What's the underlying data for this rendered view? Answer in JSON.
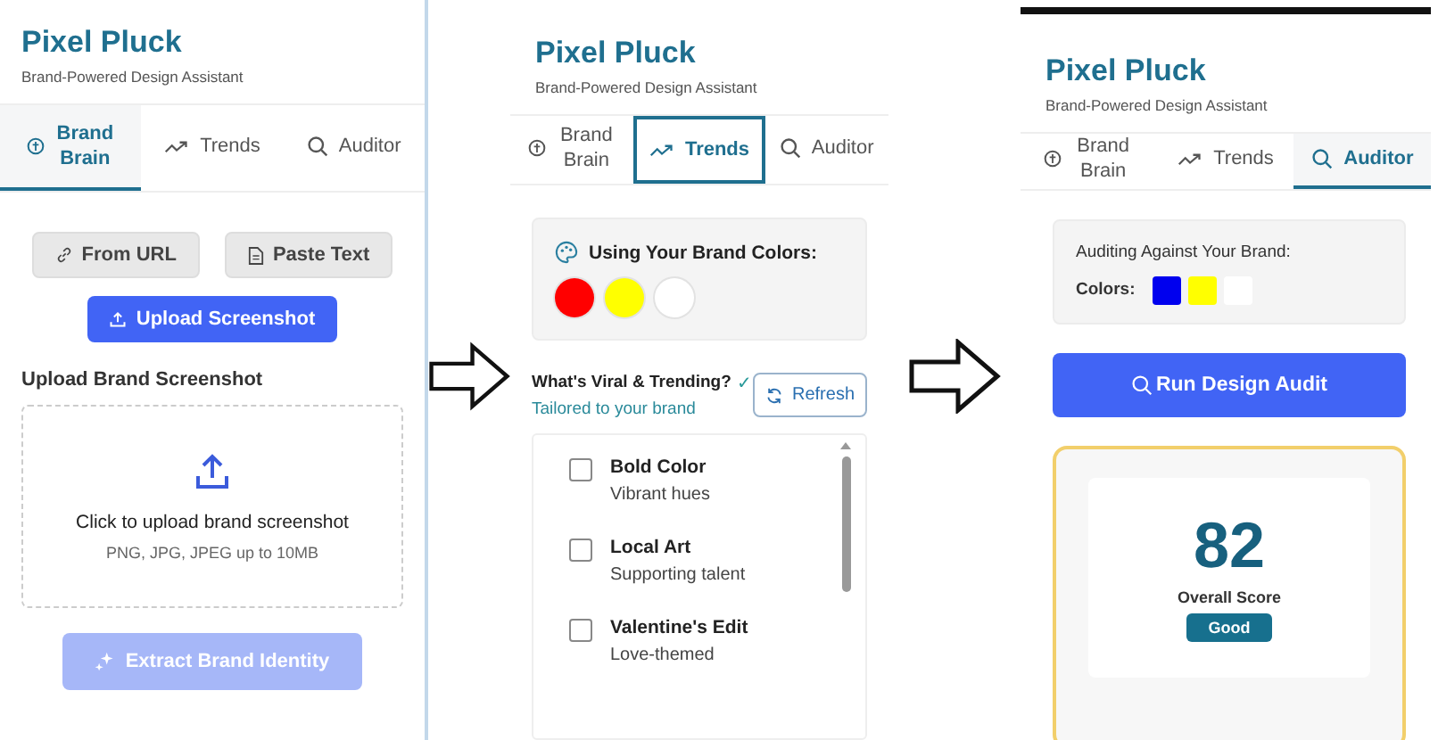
{
  "panels": [
    {
      "kind": "brand_brain",
      "title": "Pixel Pluck",
      "subtitle": "Brand-Powered Design Assistant",
      "tabs": [
        {
          "label": "Brand Brain",
          "selected": true,
          "focused": false
        },
        {
          "label": "Trends",
          "selected": false,
          "focused": false
        },
        {
          "label": "Auditor",
          "selected": false,
          "focused": false
        }
      ],
      "source_buttons": [
        "From URL",
        "Paste Text"
      ],
      "upload_button": "Upload Screenshot",
      "section_label": "Upload Brand Screenshot",
      "dropzone": {
        "title": "Click to upload brand screenshot",
        "hint": "PNG, JPG, JPEG up to 10MB"
      },
      "extract_button": {
        "label": "Extract Brand Identity",
        "disabled": true
      }
    },
    {
      "kind": "trends",
      "title": "Pixel Pluck",
      "subtitle": "Brand-Powered Design Assistant",
      "tabs": [
        {
          "label": "Brand Brain",
          "selected": false,
          "focused": false
        },
        {
          "label": "Trends",
          "selected": true,
          "focused": true
        },
        {
          "label": "Auditor",
          "selected": false,
          "focused": false
        }
      ],
      "colors_label": "Using Your Brand Colors:",
      "colors": [
        {
          "color": "#ff0000"
        },
        {
          "color": "#ffff00"
        },
        {
          "color": "#ffffff"
        }
      ],
      "heading": "What's Viral & Trending?",
      "heading_mark": "✓",
      "tagline": "Tailored to your brand",
      "refresh_button": "Refresh",
      "trends": [
        {
          "name": "Bold Color",
          "note": "Vibrant hues",
          "checked": false
        },
        {
          "name": "Local Art",
          "note": "Supporting talent",
          "checked": false
        },
        {
          "name": "Valentine's Edit",
          "note": "Love-themed",
          "checked": false
        }
      ]
    },
    {
      "kind": "auditor",
      "title": "Pixel Pluck",
      "subtitle": "Brand-Powered Design Assistant",
      "tabs": [
        {
          "label": "Brand Brain",
          "selected": false,
          "focused": false
        },
        {
          "label": "Trends",
          "selected": false,
          "focused": false
        },
        {
          "label": "Auditor",
          "selected": true,
          "focused": false
        }
      ],
      "audit_label": "Auditing Against Your Brand:",
      "colors_label": "Colors:",
      "colors": [
        {
          "color": "#0000ee"
        },
        {
          "color": "#ffff00"
        },
        {
          "color": "#ffffff"
        }
      ],
      "run_button": "Run Design Audit",
      "score": {
        "value": "82",
        "label": "Overall Score",
        "rating": "Good"
      }
    }
  ]
}
